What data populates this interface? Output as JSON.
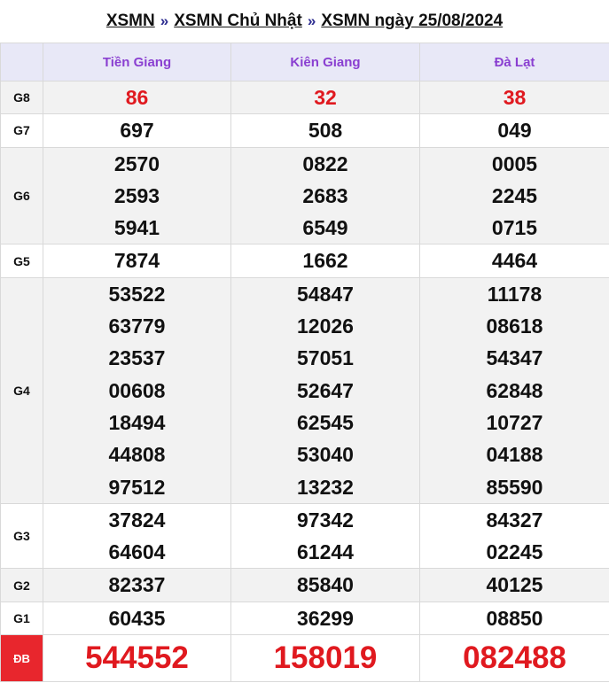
{
  "breadcrumb": {
    "part1": "XSMN",
    "part2": "XSMN Chủ Nhật",
    "part3": "XSMN ngày 25/08/2024",
    "separator": "»"
  },
  "provinces": [
    "Tiền Giang",
    "Kiên Giang",
    "Đà Lạt"
  ],
  "colors": {
    "header_text": "#8a3fd1",
    "highlight": "#e0191f",
    "db_badge": "#e8262d",
    "header_bg": "#e8e8f7",
    "shade_bg": "#f2f2f2"
  },
  "prizes": [
    {
      "label": "G8",
      "values": [
        [
          "86"
        ],
        [
          "32"
        ],
        [
          "38"
        ]
      ]
    },
    {
      "label": "G7",
      "values": [
        [
          "697"
        ],
        [
          "508"
        ],
        [
          "049"
        ]
      ]
    },
    {
      "label": "G6",
      "values": [
        [
          "2570",
          "2593",
          "5941"
        ],
        [
          "0822",
          "2683",
          "6549"
        ],
        [
          "0005",
          "2245",
          "0715"
        ]
      ]
    },
    {
      "label": "G5",
      "values": [
        [
          "7874"
        ],
        [
          "1662"
        ],
        [
          "4464"
        ]
      ]
    },
    {
      "label": "G4",
      "values": [
        [
          "53522",
          "63779",
          "23537",
          "00608",
          "18494",
          "44808",
          "97512"
        ],
        [
          "54847",
          "12026",
          "57051",
          "52647",
          "62545",
          "53040",
          "13232"
        ],
        [
          "11178",
          "08618",
          "54347",
          "62848",
          "10727",
          "04188",
          "85590"
        ]
      ]
    },
    {
      "label": "G3",
      "values": [
        [
          "37824",
          "64604"
        ],
        [
          "97342",
          "61244"
        ],
        [
          "84327",
          "02245"
        ]
      ]
    },
    {
      "label": "G2",
      "values": [
        [
          "82337"
        ],
        [
          "85840"
        ],
        [
          "40125"
        ]
      ]
    },
    {
      "label": "G1",
      "values": [
        [
          "60435"
        ],
        [
          "36299"
        ],
        [
          "08850"
        ]
      ]
    },
    {
      "label": "ĐB",
      "values": [
        [
          "544552"
        ],
        [
          "158019"
        ],
        [
          "082488"
        ]
      ]
    }
  ]
}
